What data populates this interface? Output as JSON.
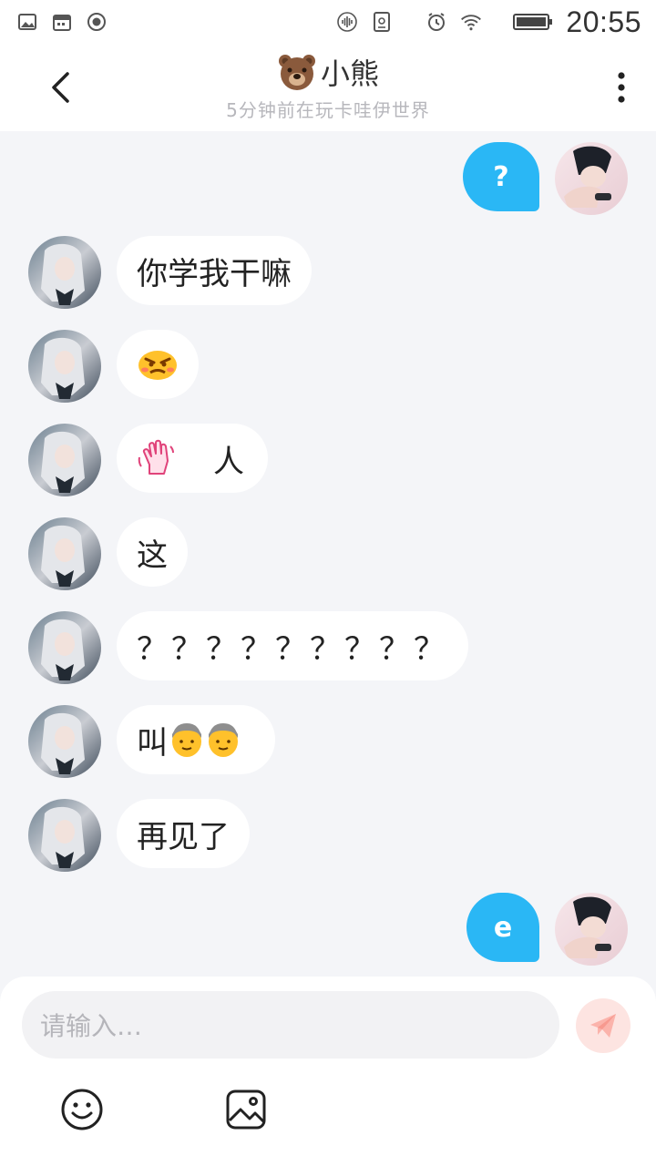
{
  "status_bar": {
    "time": "20:55",
    "left_icons": [
      "image-icon",
      "calendar-icon",
      "record-icon"
    ],
    "right_icons": [
      "voice-icon",
      "sim-icon",
      "alarm-icon",
      "wifi-icon",
      "battery-icon"
    ]
  },
  "header": {
    "title": "小熊",
    "subtitle": "5分钟前在玩卡哇伊世界"
  },
  "messages": [
    {
      "side": "right",
      "text": "?"
    },
    {
      "side": "left",
      "text": "你学我干嘛"
    },
    {
      "side": "left",
      "text": "",
      "emoji": [
        "angry-face-emoji"
      ]
    },
    {
      "side": "left",
      "text": "人",
      "emoji": [
        "waving-hand-emoji"
      ]
    },
    {
      "side": "left",
      "text": "这"
    },
    {
      "side": "left",
      "text": "？？？？？？？？？"
    },
    {
      "side": "left",
      "text": "叫",
      "emoji": [
        "old-man-emoji",
        "old-man-emoji"
      ]
    },
    {
      "side": "left",
      "text": "再见了"
    },
    {
      "side": "right",
      "text": "e"
    }
  ],
  "input": {
    "placeholder": "请输入…"
  },
  "colors": {
    "sent_bubble": "#2ab7f5",
    "received_bubble": "#ffffff",
    "chat_background": "#f4f5f8",
    "send_button": "#fde4e1"
  }
}
